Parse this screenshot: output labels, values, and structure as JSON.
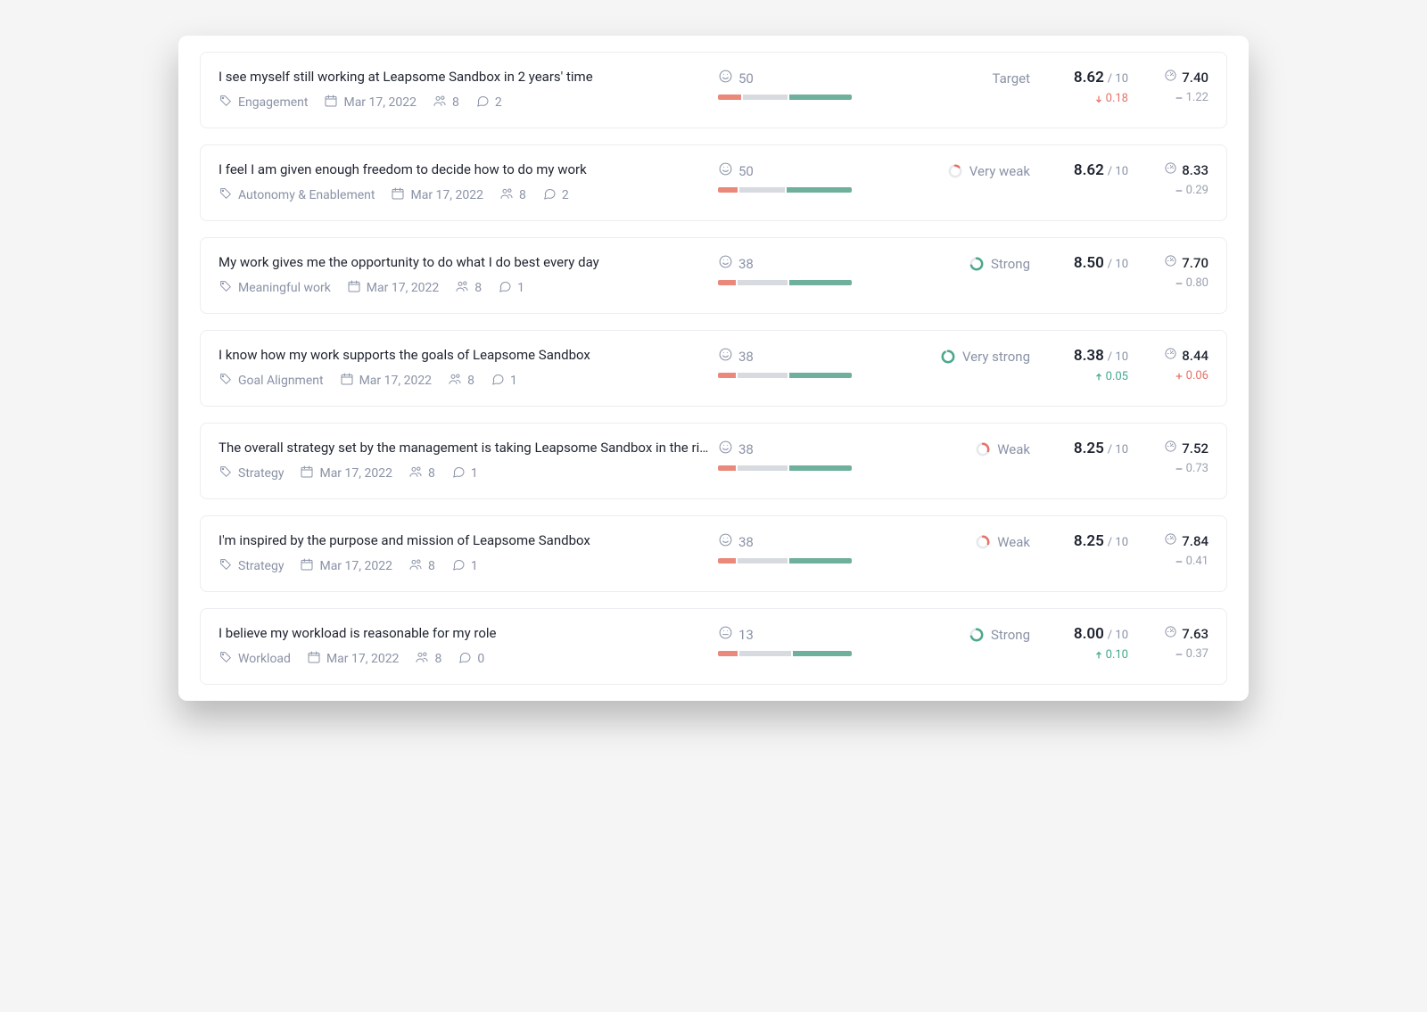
{
  "score_max": "/ 10",
  "colors": {
    "red": "#e9887b",
    "gray": "#d7dbe0",
    "green": "#6fb09c",
    "ring_green": "#4aa88b",
    "ring_red": "#e57368"
  },
  "items": [
    {
      "title": "I see myself still working at Leapsome Sandbox in 2 years' time",
      "category": "Engagement",
      "date": "Mar 17, 2022",
      "people": "8",
      "comments": "2",
      "sentiment": "50",
      "bar": [
        18,
        34,
        48
      ],
      "strength": {
        "label": "Target",
        "type": "target"
      },
      "score": "8.62",
      "delta": {
        "label": "0.18",
        "dir": "down",
        "color": "red"
      },
      "bench": "7.40",
      "bench_delta": {
        "label": "1.22",
        "dir": "dash",
        "color": "gray"
      }
    },
    {
      "title": "I feel I am given enough freedom to decide how to do my work",
      "category": "Autonomy & Enablement",
      "date": "Mar 17, 2022",
      "people": "8",
      "comments": "2",
      "sentiment": "50",
      "bar": [
        15,
        35,
        50
      ],
      "strength": {
        "label": "Very weak",
        "type": "ring",
        "color": "#e57368",
        "frac": 0.12
      },
      "score": "8.62",
      "delta": null,
      "bench": "8.33",
      "bench_delta": {
        "label": "0.29",
        "dir": "dash",
        "color": "gray"
      }
    },
    {
      "title": "My work gives me the opportunity to do what I do best every day",
      "category": "Meaningful work",
      "date": "Mar 17, 2022",
      "people": "8",
      "comments": "1",
      "sentiment": "38",
      "bar": [
        14,
        38,
        48
      ],
      "strength": {
        "label": "Strong",
        "type": "ring",
        "color": "#4aa88b",
        "frac": 0.7
      },
      "score": "8.50",
      "delta": null,
      "bench": "7.70",
      "bench_delta": {
        "label": "0.80",
        "dir": "dash",
        "color": "gray"
      }
    },
    {
      "title": "I know how my work supports the goals of Leapsome Sandbox",
      "category": "Goal Alignment",
      "date": "Mar 17, 2022",
      "people": "8",
      "comments": "1",
      "sentiment": "38",
      "bar": [
        14,
        38,
        48
      ],
      "strength": {
        "label": "Very strong",
        "type": "ring",
        "color": "#4aa88b",
        "frac": 0.9
      },
      "score": "8.38",
      "delta": {
        "label": "0.05",
        "dir": "up",
        "color": "green"
      },
      "bench": "8.44",
      "bench_delta": {
        "label": "0.06",
        "dir": "plus",
        "color": "red"
      }
    },
    {
      "title": "The overall strategy set by the management is taking Leapsome Sandbox in the right direc...",
      "category": "Strategy",
      "date": "Mar 17, 2022",
      "people": "8",
      "comments": "1",
      "sentiment": "38",
      "bar": [
        14,
        38,
        48
      ],
      "strength": {
        "label": "Weak",
        "type": "ring",
        "color": "#e57368",
        "frac": 0.3
      },
      "score": "8.25",
      "delta": null,
      "bench": "7.52",
      "bench_delta": {
        "label": "0.73",
        "dir": "dash",
        "color": "gray"
      }
    },
    {
      "title": "I'm inspired by the purpose and mission of Leapsome Sandbox",
      "category": "Strategy",
      "date": "Mar 17, 2022",
      "people": "8",
      "comments": "1",
      "sentiment": "38",
      "bar": [
        14,
        38,
        48
      ],
      "strength": {
        "label": "Weak",
        "type": "ring",
        "color": "#e57368",
        "frac": 0.3
      },
      "score": "8.25",
      "delta": null,
      "bench": "7.84",
      "bench_delta": {
        "label": "0.41",
        "dir": "dash",
        "color": "gray"
      }
    },
    {
      "title": "I believe my workload is reasonable for my role",
      "category": "Workload",
      "date": "Mar 17, 2022",
      "people": "8",
      "comments": "0",
      "sentiment": "13",
      "bar": [
        15,
        40,
        45
      ],
      "strength": {
        "label": "Strong",
        "type": "ring",
        "color": "#4aa88b",
        "frac": 0.7
      },
      "score": "8.00",
      "delta": {
        "label": "0.10",
        "dir": "up",
        "color": "green"
      },
      "bench": "7.63",
      "bench_delta": {
        "label": "0.37",
        "dir": "dash",
        "color": "gray"
      }
    }
  ]
}
